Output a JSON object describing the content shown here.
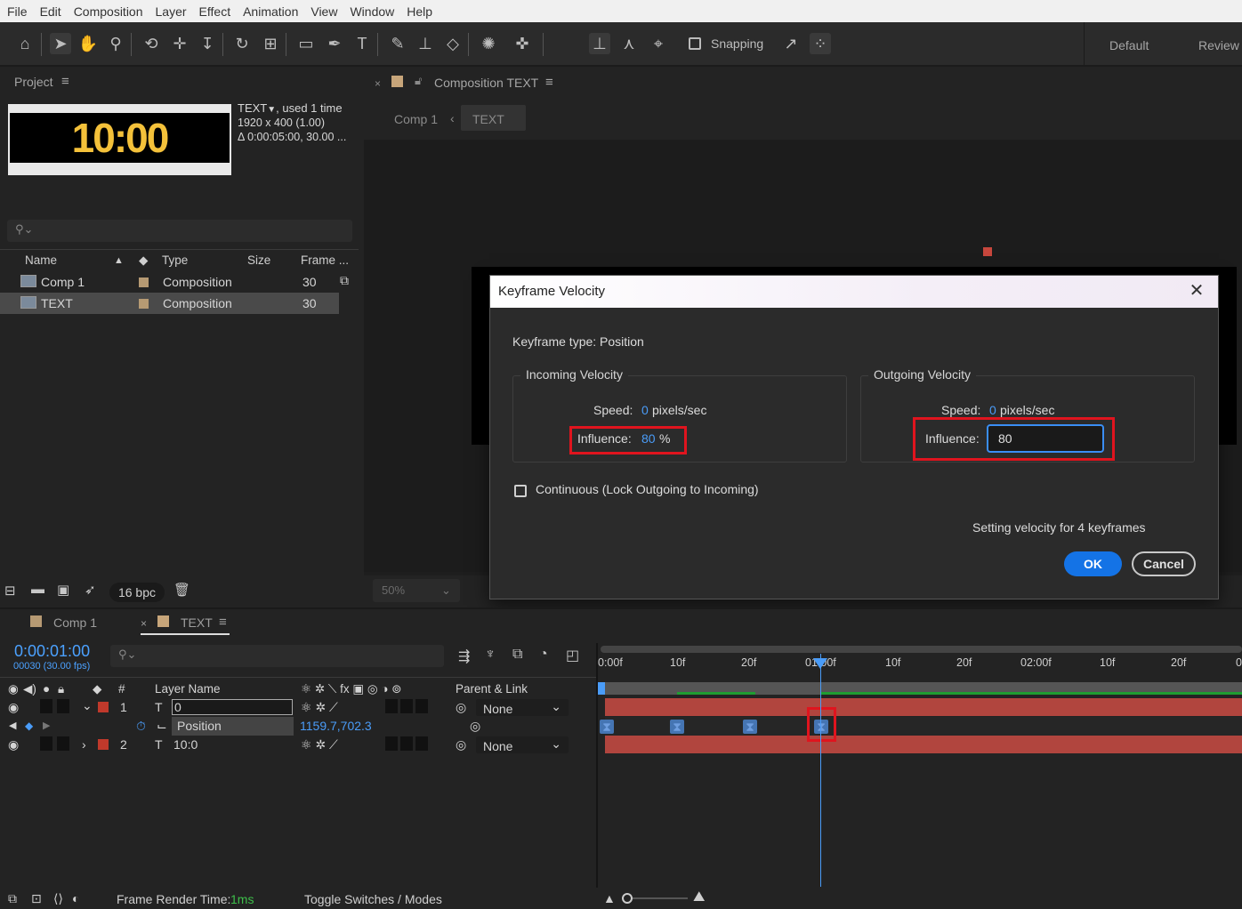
{
  "menu": [
    "File",
    "Edit",
    "Composition",
    "Layer",
    "Effect",
    "Animation",
    "View",
    "Window",
    "Help"
  ],
  "toolbar": {
    "snapping_label": "Snapping",
    "workspace_default": "Default",
    "workspace_review": "Review"
  },
  "project": {
    "title": "Project",
    "preview_text": "10:00",
    "item_name": "TEXT",
    "used": ", used 1 time",
    "dims": "1920 x 400 (1.00)",
    "duration": "Δ 0:00:05:00, 30.00 ...",
    "columns": {
      "name": "Name",
      "type": "Type",
      "size": "Size",
      "frame": "Frame ..."
    },
    "rows": [
      {
        "name": "Comp 1",
        "type": "Composition",
        "frame": "30"
      },
      {
        "name": "TEXT",
        "type": "Composition",
        "frame": "30"
      }
    ],
    "bpc": "16 bpc"
  },
  "composition": {
    "tab_title": "Composition TEXT",
    "breadcrumb_comp1": "Comp 1",
    "breadcrumb_text": "TEXT",
    "zoom": "50%"
  },
  "dialog": {
    "title": "Keyframe Velocity",
    "keyframe_type": "Keyframe type: Position",
    "incoming_label": "Incoming Velocity",
    "outgoing_label": "Outgoing Velocity",
    "speed_label": "Speed:",
    "in_speed_value": "0",
    "out_speed_value": "0",
    "speed_unit": "pixels/sec",
    "influence_label": "Influence:",
    "in_influence_value": "80",
    "in_influence_unit": "%",
    "out_influence_value": "80",
    "continuous_label": "Continuous (Lock Outgoing to Incoming)",
    "status": "Setting velocity for 4 keyframes",
    "ok": "OK",
    "cancel": "Cancel"
  },
  "timeline": {
    "tab_comp1": "Comp 1",
    "tab_text": "TEXT",
    "timecode": "0:00:01:00",
    "frames": "00030 (30.00 fps)",
    "col_num": "#",
    "col_layer_name": "Layer Name",
    "col_parent": "Parent & Link",
    "layers": [
      {
        "num": "1",
        "name": "0",
        "parent": "None"
      },
      {
        "num": "2",
        "name": "10:0",
        "parent": "None"
      }
    ],
    "position_label": "Position",
    "position_value": "1159.7,702.3",
    "ruler_ticks": [
      "0:00f",
      "10f",
      "20f",
      "01:00f",
      "10f",
      "20f",
      "02:00f",
      "10f",
      "20f",
      "0"
    ],
    "frame_render_label": "Frame Render Time:",
    "frame_render_value": "1ms",
    "toggle_label": "Toggle Switches / Modes"
  },
  "colors": {
    "accent_blue": "#1473e6",
    "highlight_red": "#e0141e",
    "layer_bar": "#b1453e"
  }
}
